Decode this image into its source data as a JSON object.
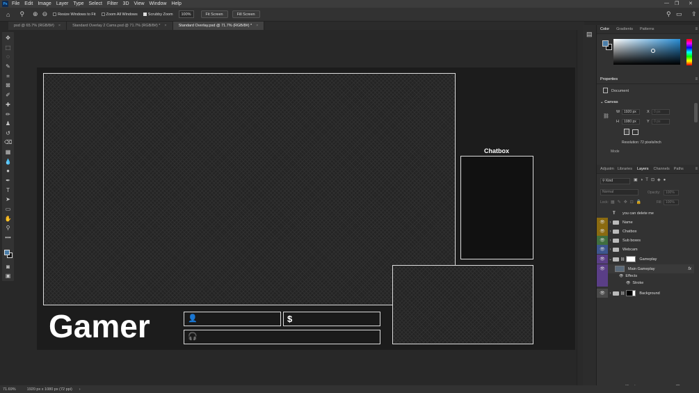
{
  "app": {
    "logo": "Ps"
  },
  "menu": [
    "File",
    "Edit",
    "Image",
    "Layer",
    "Type",
    "Select",
    "Filter",
    "3D",
    "View",
    "Window",
    "Help"
  ],
  "options": {
    "resize_windows": "Resize Windows to Fit",
    "zoom_all": "Zoom All Windows",
    "scrubby_zoom": "Scrubby Zoom",
    "zoom_pct": "100%",
    "fit_screen": "Fit Screen",
    "fill_screen": "Fill Screen"
  },
  "tabs": [
    {
      "label": "psd @ 65.7% (RGB/8#)"
    },
    {
      "label": "Standard Overlay 2 Cams.psd @ 71.7% (RGB/8#) *"
    },
    {
      "label": "Standard Overlay.psd @ 71.7% (RGB/8#) *"
    }
  ],
  "overlay": {
    "chatbox_title": "Chatbox",
    "gamer_text": "Gamer",
    "user_glyph": "👤",
    "dollar_glyph": "$",
    "headset_glyph": "🎧"
  },
  "statusbar": {
    "zoom": "71.69%",
    "doc_info": "1920 px x 1080 px (72 ppi)"
  },
  "color_panel": {
    "tabs": [
      "Color",
      "Gradients",
      "Patterns"
    ],
    "foreground": "#4a7da8",
    "background": "#111111"
  },
  "properties": {
    "title": "Properties",
    "document_label": "Document",
    "canvas_label": "Canvas",
    "w_label": "W",
    "w_value": "1920 px",
    "h_label": "H",
    "h_value": "1080 px",
    "x_label": "X",
    "x_value": "0 px",
    "y_label": "Y",
    "y_value": "0 px",
    "resolution": "Resolution: 72 pixels/inch",
    "mode_label": "Mode"
  },
  "layers_panel": {
    "tabs": [
      "Adjustm",
      "Libraries",
      "Layers",
      "Channels",
      "Paths"
    ],
    "kind": "Kind",
    "blend": "Normal",
    "opacity_label": "Opacity:",
    "opacity": "100%",
    "lock_label": "Lock:",
    "fill_label": "Fill:",
    "fill": "100%",
    "layers": [
      {
        "name": "you can delete me",
        "type": "text",
        "color": "none"
      },
      {
        "name": "Name",
        "type": "group",
        "color": "#d4a017"
      },
      {
        "name": "Chatbox",
        "type": "group",
        "color": "#d4a017"
      },
      {
        "name": "Sub boxes",
        "type": "group",
        "color": "#4ca84c"
      },
      {
        "name": "Webcam",
        "type": "group",
        "color": "#4a6ec8"
      },
      {
        "name": "Gameplay",
        "type": "group",
        "color": "#7a4ab0"
      },
      {
        "name": "Main Gameplay",
        "type": "layer",
        "color": "#7a4ab0"
      },
      {
        "name": "Effects",
        "type": "effect",
        "color": "#7a4ab0"
      },
      {
        "name": "Stroke",
        "type": "effect",
        "color": "#7a4ab0"
      },
      {
        "name": "Background",
        "type": "group",
        "color": "#555555"
      }
    ],
    "fx_label": "fx"
  }
}
